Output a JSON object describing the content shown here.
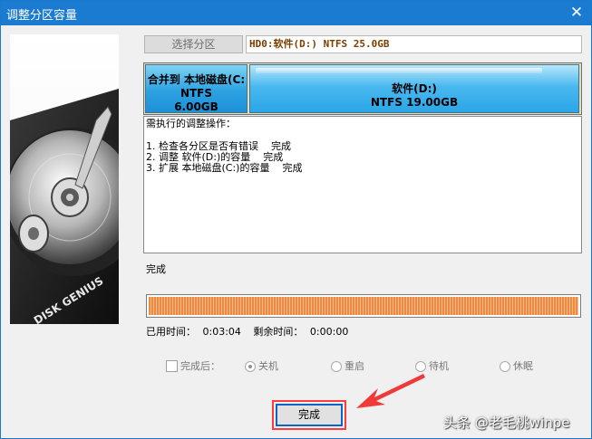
{
  "window": {
    "title": "调整分区容量"
  },
  "toolbar": {
    "select_partition_label": "选择分区",
    "disk_info": "HD0:软件(D:) NTFS 25.0GB"
  },
  "partitions": [
    {
      "line1": "合并到 本地磁盘(C:",
      "line2": "NTFS",
      "line3": "6.00GB"
    },
    {
      "line1": "软件(D:)",
      "line2": "NTFS 19.00GB"
    }
  ],
  "operations": {
    "title": "需执行的调整操作：",
    "items": [
      "1. 检查各分区是否有错误    完成",
      "2. 调整 软件(D:)的容量    完成",
      "3. 扩展 本地磁盘(C:)的容量    完成"
    ]
  },
  "status": {
    "text": "完成",
    "progress_percent": 100
  },
  "time": {
    "elapsed_label": "已用时间：",
    "elapsed_value": "0:03:04",
    "remaining_label": "剩余时间：",
    "remaining_value": "0:00:00"
  },
  "after_completion": {
    "label": "完成后：",
    "checked": false,
    "options": [
      {
        "label": "关机",
        "selected": true
      },
      {
        "label": "重启",
        "selected": false
      },
      {
        "label": "待机",
        "selected": false
      },
      {
        "label": "休眠",
        "selected": false
      }
    ]
  },
  "buttons": {
    "finish_label": "完成"
  },
  "side_image": {
    "brand_text": "DISK GENIUS"
  },
  "watermark": "头条 @老毛桃winpe",
  "colors": {
    "titlebar": "#1b7bd0",
    "progress": "#ee8a3f",
    "highlight": "#ff3d3d"
  }
}
